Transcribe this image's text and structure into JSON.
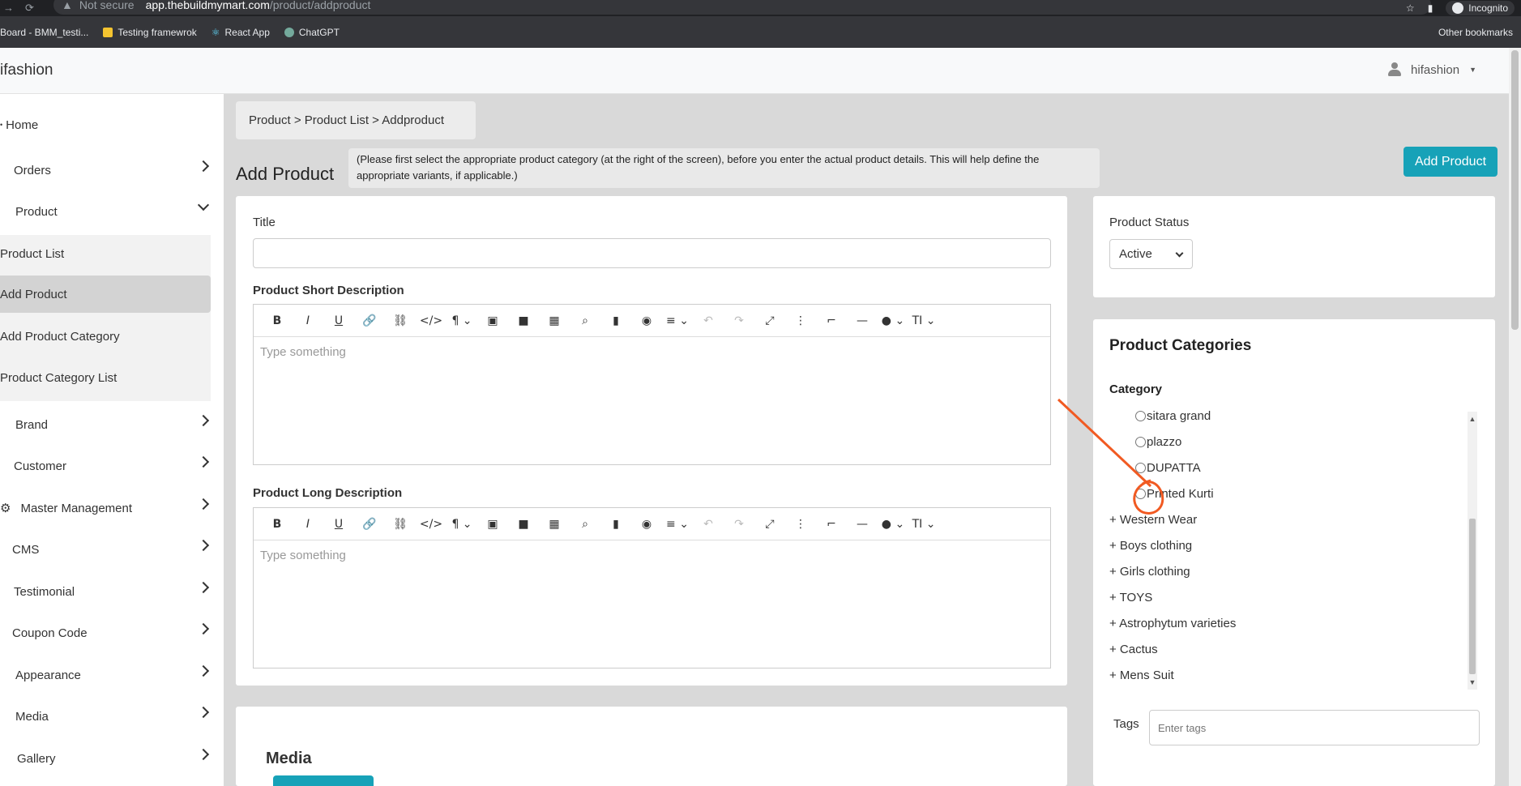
{
  "browser": {
    "not_secure": "Not secure",
    "url_host": "app.thebuildmymart.com",
    "url_path": "/product/addproduct",
    "incognito": "Incognito",
    "bookmarks": [
      "Board - BMM_testi...",
      "Testing framewrok",
      "React App",
      "ChatGPT"
    ],
    "other_bookmarks": "Other bookmarks"
  },
  "header": {
    "brand": "ifashion",
    "user": "hifashion"
  },
  "sidebar": {
    "items": [
      {
        "label": "Home"
      },
      {
        "label": "Orders"
      },
      {
        "label": "Product"
      },
      {
        "label": "Brand"
      },
      {
        "label": "Customer"
      },
      {
        "label": "Master Management"
      },
      {
        "label": "CMS"
      },
      {
        "label": "Testimonial"
      },
      {
        "label": "Coupon Code"
      },
      {
        "label": "Appearance"
      },
      {
        "label": "Media"
      },
      {
        "label": "Gallery"
      }
    ],
    "product_sub": [
      {
        "label": "Product List"
      },
      {
        "label": "Add Product"
      },
      {
        "label": "Add Product Category"
      },
      {
        "label": "Product Category List"
      }
    ]
  },
  "main": {
    "breadcrumb": "Product > Product List > Addproduct",
    "title": "Add Product",
    "hint": "(Please first select the appropriate product category (at the right of the screen), before you enter the actual product details. This will help define the appropriate variants, if applicable.)",
    "add_button": "Add Product",
    "form": {
      "title_label": "Title",
      "title_value": "",
      "short_desc_label": "Product Short Description",
      "long_desc_label": "Product Long Description",
      "editor_placeholder": "Type something",
      "media_heading": "Media"
    }
  },
  "right": {
    "status_label": "Product Status",
    "status_value": "Active",
    "categories_heading": "Product Categories",
    "category_label": "Category",
    "sub_categories": [
      "sitara grand",
      "plazzo",
      "DUPATTA",
      "Printed Kurti"
    ],
    "categories": [
      "+ Western Wear",
      "+ Boys clothing",
      "+ Girls clothing",
      "+ TOYS",
      "+ Astrophytum varieties",
      "+ Cactus",
      "+ Mens Suit"
    ],
    "tags_label": "Tags",
    "tags_placeholder": "Enter tags"
  },
  "colors": {
    "accent": "#17a2b8",
    "annotation": "#f15a22"
  },
  "icons": [
    "back-icon",
    "reload-icon",
    "warning-icon",
    "star-icon",
    "user-icon",
    "chevron-right-icon",
    "chevron-down-icon"
  ]
}
